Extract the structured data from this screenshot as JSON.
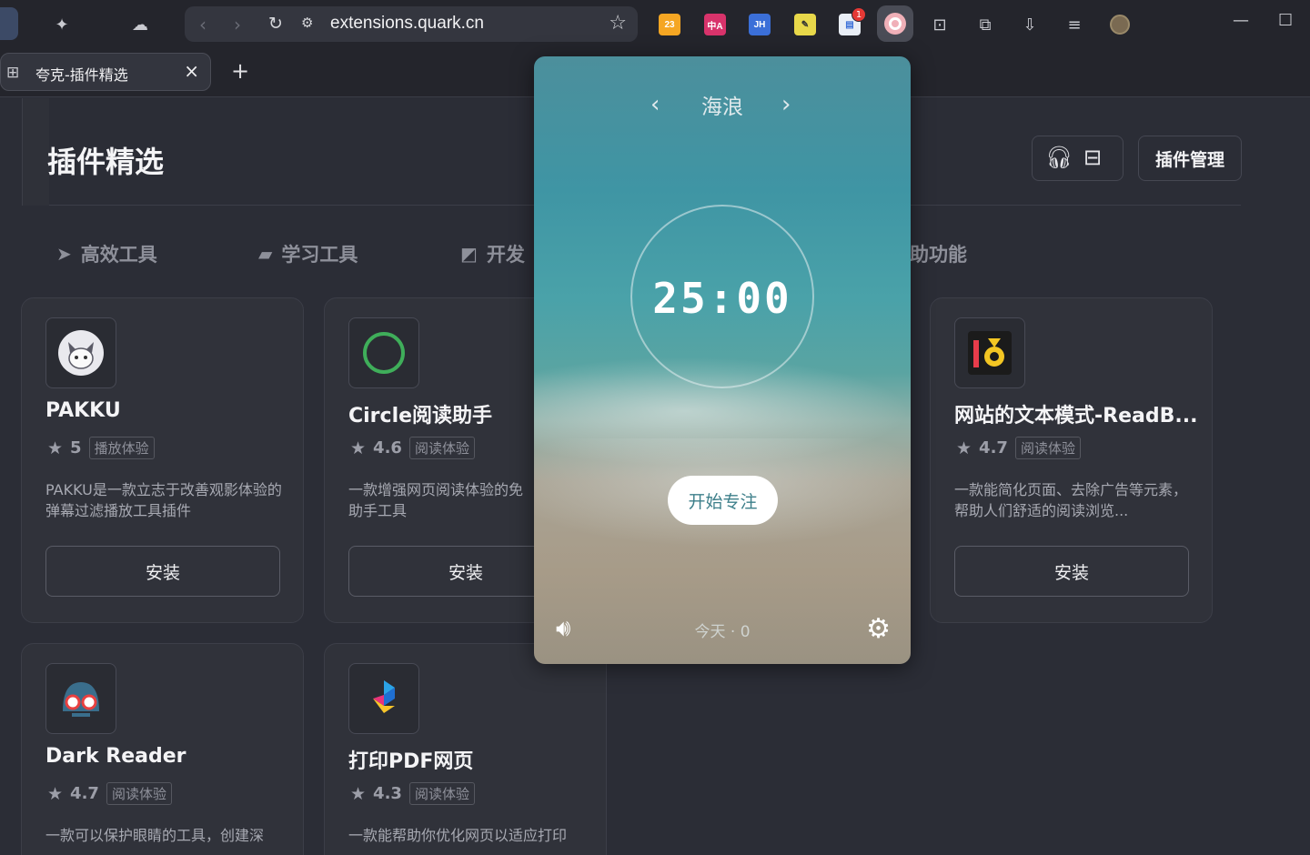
{
  "browser": {
    "url": "extensions.quark.cn",
    "tab_title": "夸克-插件精选",
    "extension_badge": "1",
    "calendar_icon_text": "23",
    "jh_icon_text": "JH",
    "translate_icon_text": "中A"
  },
  "page": {
    "title": "插件精选",
    "manage_button": "插件管理",
    "categories": [
      {
        "label": "高效工具",
        "icon": "paper-plane-icon"
      },
      {
        "label": "学习工具",
        "icon": "book-icon"
      },
      {
        "label": "开发",
        "icon": "terminal-icon"
      },
      {
        "label": "助功能",
        "icon": ""
      }
    ],
    "cards": [
      {
        "name": "PAKKU",
        "rating": "5",
        "tag": "播放体验",
        "desc": "PAKKU是一款立志于改善观影体验的弹幕过滤播放工具插件",
        "install": "安装",
        "logo": "cat-avatar-icon"
      },
      {
        "name": "Circle阅读助手",
        "rating": "4.6",
        "tag": "阅读体验",
        "desc": "一款增强网页阅读体验的免助手工具",
        "install": "安装",
        "logo": "green-circle-icon"
      },
      {
        "name": "网站的文本模式-ReadB...",
        "rating": "4.7",
        "tag": "阅读体验",
        "desc": "一款能简化页面、去除广告等元素，帮助人们舒适的阅读浏览...",
        "install": "安装",
        "logo": "readb-logo-icon"
      },
      {
        "name": "Dark Reader",
        "rating": "4.7",
        "tag": "阅读体验",
        "desc": "一款可以保护眼睛的工具，创建深",
        "install": "安装",
        "logo": "dark-reader-icon"
      },
      {
        "name": "打印PDF网页",
        "rating": "4.3",
        "tag": "阅读体验",
        "desc": "一款能帮助你优化网页以适应打印",
        "install": "安装",
        "logo": "print-pdf-icon"
      }
    ]
  },
  "popup": {
    "scene": "海浪",
    "timer": "25:00",
    "start_button": "开始专注",
    "today": "今天 · 0"
  },
  "colors": {
    "page_bg": "#2b2d36",
    "card_bg": "#30323a",
    "chrome_bg": "#24252c",
    "popup_accent": "#3d7f8a"
  }
}
